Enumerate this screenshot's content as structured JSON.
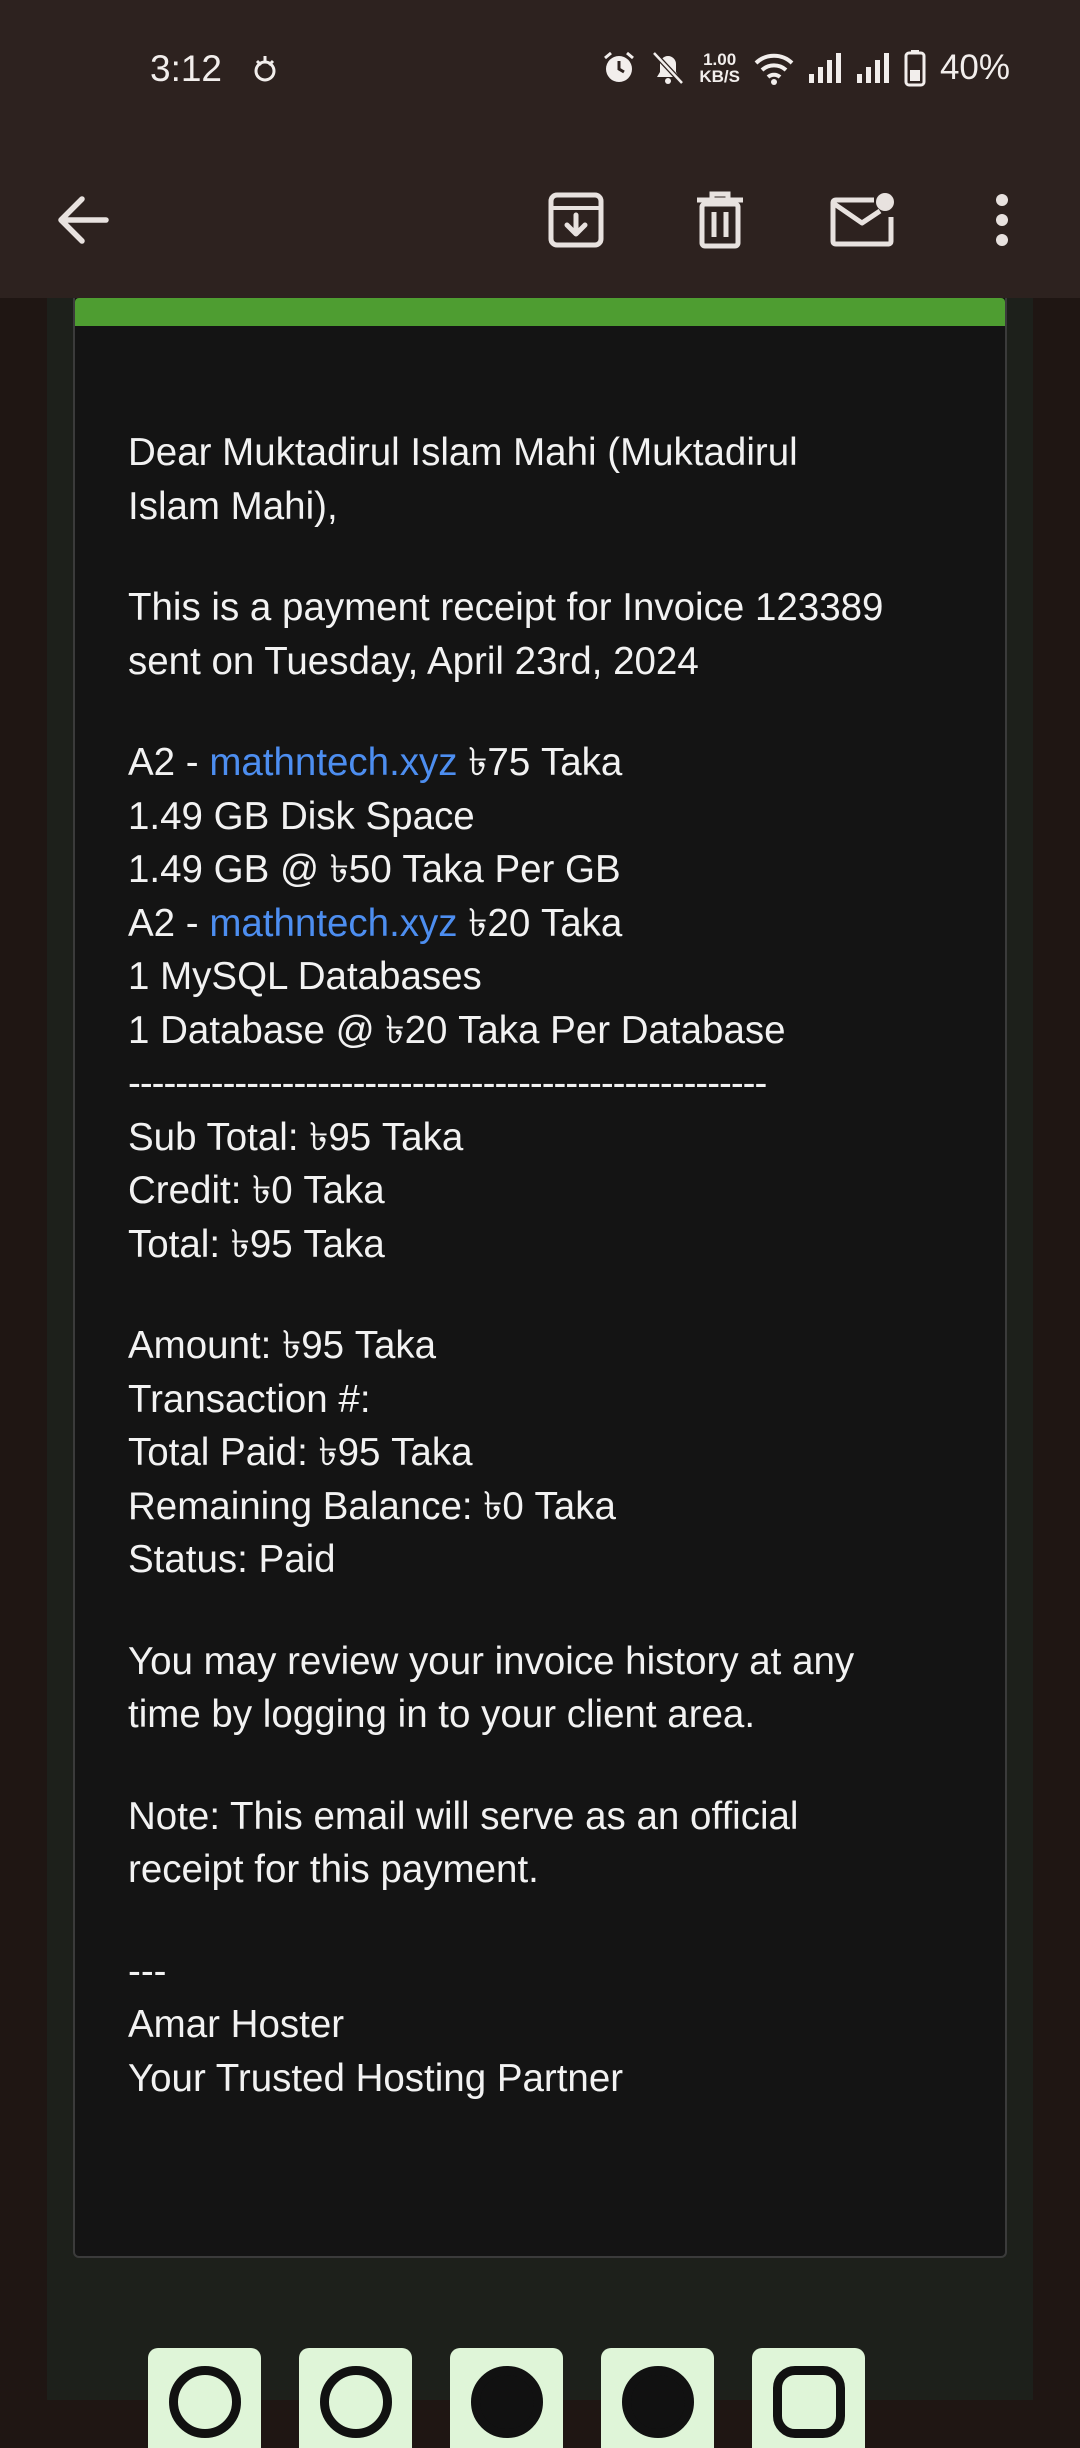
{
  "status_bar": {
    "time": "3:12",
    "net_speed_value": "1.00",
    "net_speed_unit": "KB/S",
    "battery": "40%",
    "icons": [
      "alarm-icon",
      "bell-off-icon",
      "wifi-icon",
      "signal-icon",
      "signal-icon",
      "battery-icon"
    ]
  },
  "toolbar": {
    "back": "back-arrow-icon",
    "archive": "archive-icon",
    "delete": "trash-icon",
    "mark_unread": "mail-unread-icon",
    "more": "more-vert-icon"
  },
  "email": {
    "greeting_line1": "Dear Muktadirul Islam Mahi (Muktadirul",
    "greeting_line2": "Islam Mahi),",
    "intro_line1": "This is a payment receipt for Invoice 123389",
    "intro_line2": "sent on Tuesday, April 23rd, 2024",
    "items": {
      "item1_prefix": "A2 - ",
      "item1_link": "mathntech.xyz",
      "item1_price": " ৳75 Taka",
      "item1_detail1": "1.49 GB Disk Space",
      "item1_detail2": "1.49 GB @ ৳50 Taka Per GB",
      "item2_prefix": "A2 - ",
      "item2_link": "mathntech.xyz",
      "item2_price": " ৳20 Taka",
      "item2_detail1": "1 MySQL Databases",
      "item2_detail2": "1 Database @ ৳20 Taka Per Database",
      "separator": "------------------------------------------------------"
    },
    "totals": {
      "subtotal": "Sub Total: ৳95 Taka",
      "credit": "Credit: ৳0 Taka",
      "total": "Total: ৳95 Taka"
    },
    "payment": {
      "amount": "Amount: ৳95 Taka",
      "transaction": "Transaction #:",
      "total_paid": "Total Paid: ৳95 Taka",
      "remaining": "Remaining Balance: ৳0 Taka",
      "status": "Status: Paid"
    },
    "review_line1": "You may review your invoice history at any",
    "review_line2": "time by logging in to your client area.",
    "note_line1": "Note: This email will serve as an official",
    "note_line2": "receipt for this payment.",
    "signature_sep": "---",
    "signature_name": "Amar Hoster",
    "signature_tagline": "Your Trusted Hosting Partner"
  },
  "colors": {
    "accent_green": "#4e9d31",
    "link_blue": "#4d8ef0",
    "app_bar": "#2d221f",
    "card_bg": "#141414"
  },
  "social": [
    "whatsapp-icon",
    "telegram-icon",
    "facebook-icon",
    "twitter-x-icon",
    "instagram-icon"
  ]
}
